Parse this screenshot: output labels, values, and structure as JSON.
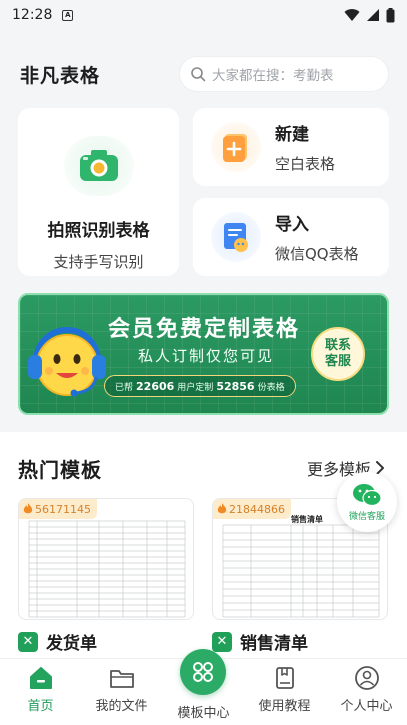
{
  "status_bar": {
    "time": "12:28",
    "sim_label": "A"
  },
  "header": {
    "app_title": "非凡表格",
    "search_placeholder": "大家都在搜：考勤表"
  },
  "quick_actions": {
    "photo": {
      "title": "拍照识别表格",
      "subtitle": "支持手写识别"
    },
    "new": {
      "title": "新建",
      "subtitle": "空白表格"
    },
    "import": {
      "title": "导入",
      "subtitle": "微信QQ表格"
    }
  },
  "banner": {
    "title": "会员免费定制表格",
    "subtitle": "私人订制仅您可见",
    "stats_prefix": "已帮",
    "users": "22606",
    "stats_middle": "用户定制",
    "tables": "52856",
    "stats_suffix": "份表格",
    "button_line1": "联系",
    "button_line2": "客服"
  },
  "templates_section": {
    "title": "热门模板",
    "more_label": "更多模板",
    "items": [
      {
        "count": "56171145",
        "name": "发货单"
      },
      {
        "count": "21844866",
        "name": "销售清单",
        "sheet_title": "销售清单"
      }
    ]
  },
  "floating": {
    "wechat_label": "微信客服"
  },
  "tabs": [
    {
      "label": "首页"
    },
    {
      "label": "我的文件"
    },
    {
      "label": "模板中心"
    },
    {
      "label": "使用教程"
    },
    {
      "label": "个人中心"
    }
  ],
  "colors": {
    "brand_green": "#1d9a57",
    "banner_green": "#2c9a63",
    "badge_orange": "#d6822a"
  }
}
